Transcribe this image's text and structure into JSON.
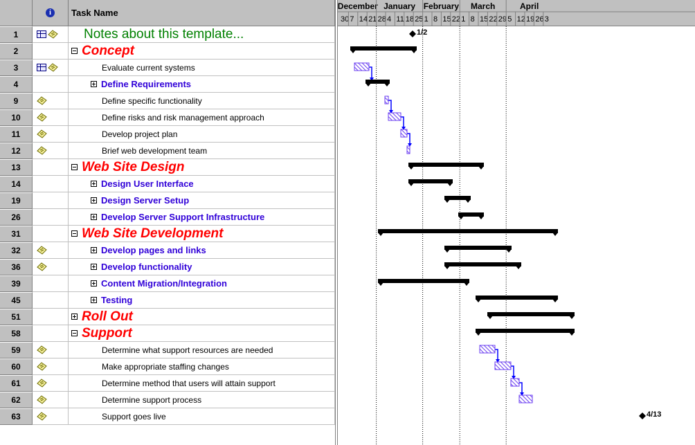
{
  "table": {
    "header": {
      "task_name": "Task Name"
    },
    "rows": [
      {
        "id": "1",
        "name": "Notes about this template...",
        "level": "title",
        "toggle": "",
        "indicators": [
          "grid",
          "note"
        ]
      },
      {
        "id": "2",
        "name": "Concept",
        "level": "phase",
        "toggle": "minus",
        "indicators": []
      },
      {
        "id": "3",
        "name": "Evaluate current systems",
        "level": "task",
        "toggle": "",
        "indicators": [
          "grid",
          "note"
        ]
      },
      {
        "id": "4",
        "name": "Define Requirements",
        "level": "summary",
        "toggle": "plus",
        "indicators": []
      },
      {
        "id": "9",
        "name": "Define specific functionality",
        "level": "task",
        "toggle": "",
        "indicators": [
          "note"
        ]
      },
      {
        "id": "10",
        "name": "Define risks and risk management approach",
        "level": "task",
        "toggle": "",
        "indicators": [
          "note"
        ]
      },
      {
        "id": "11",
        "name": "Develop project plan",
        "level": "task",
        "toggle": "",
        "indicators": [
          "note"
        ]
      },
      {
        "id": "12",
        "name": "Brief web development team",
        "level": "task",
        "toggle": "",
        "indicators": [
          "note"
        ]
      },
      {
        "id": "13",
        "name": "Web Site Design",
        "level": "phase",
        "toggle": "minus",
        "indicators": []
      },
      {
        "id": "14",
        "name": "Design User Interface",
        "level": "summary",
        "toggle": "plus",
        "indicators": []
      },
      {
        "id": "19",
        "name": "Design Server Setup",
        "level": "summary",
        "toggle": "plus",
        "indicators": []
      },
      {
        "id": "26",
        "name": "Develop Server Support Infrastructure",
        "level": "summary",
        "toggle": "plus",
        "indicators": []
      },
      {
        "id": "31",
        "name": "Web Site Development",
        "level": "phase",
        "toggle": "minus",
        "indicators": []
      },
      {
        "id": "32",
        "name": "Develop pages and links",
        "level": "summary",
        "toggle": "plus",
        "indicators": [
          "note"
        ]
      },
      {
        "id": "36",
        "name": "Develop functionality",
        "level": "summary",
        "toggle": "plus",
        "indicators": [
          "note"
        ]
      },
      {
        "id": "39",
        "name": "Content Migration/Integration",
        "level": "summary",
        "toggle": "plus",
        "indicators": []
      },
      {
        "id": "45",
        "name": "Testing",
        "level": "summary",
        "toggle": "plus",
        "indicators": []
      },
      {
        "id": "51",
        "name": "Roll Out",
        "level": "phase",
        "toggle": "plus",
        "indicators": []
      },
      {
        "id": "58",
        "name": "Support",
        "level": "phase",
        "toggle": "minus",
        "indicators": []
      },
      {
        "id": "59",
        "name": "Determine what support resources are needed",
        "level": "task",
        "toggle": "",
        "indicators": [
          "note"
        ]
      },
      {
        "id": "60",
        "name": "Make appropriate staffing changes",
        "level": "task",
        "toggle": "",
        "indicators": [
          "note"
        ]
      },
      {
        "id": "61",
        "name": "Determine method that users will attain support",
        "level": "task",
        "toggle": "",
        "indicators": [
          "note"
        ]
      },
      {
        "id": "62",
        "name": "Determine support process",
        "level": "task",
        "toggle": "",
        "indicators": [
          "note"
        ]
      },
      {
        "id": "63",
        "name": "Support goes live",
        "level": "task",
        "toggle": "",
        "indicators": [
          "note"
        ]
      }
    ]
  },
  "timescale": {
    "months": [
      "December",
      "January",
      "February",
      "March",
      "April"
    ],
    "weeks": [
      "30",
      "7",
      "14",
      "21",
      "28",
      "4",
      "11",
      "18",
      "25",
      "1",
      "8",
      "15",
      "22",
      "1",
      "8",
      "15",
      "22",
      "29",
      "5",
      "12",
      "19",
      "26",
      "3"
    ]
  },
  "gantt": {
    "bars": [
      {
        "row": 0,
        "type": "milestone",
        "start": "1/2",
        "label": "1/2"
      },
      {
        "row": 1,
        "type": "summary",
        "start": 18,
        "end": 114
      },
      {
        "row": 2,
        "type": "task",
        "start": 24,
        "end": 45
      },
      {
        "row": 3,
        "type": "summary",
        "start": 40,
        "end": 75
      },
      {
        "row": 4,
        "type": "task",
        "start": 68,
        "end": 73
      },
      {
        "row": 5,
        "type": "task",
        "start": 73,
        "end": 91
      },
      {
        "row": 6,
        "type": "task",
        "start": 91,
        "end": 100
      },
      {
        "row": 7,
        "type": "task",
        "start": 100,
        "end": 104
      },
      {
        "row": 8,
        "type": "summary",
        "start": 102,
        "end": 211
      },
      {
        "row": 9,
        "type": "summary",
        "start": 102,
        "end": 166
      },
      {
        "row": 10,
        "type": "summary",
        "start": 154,
        "end": 192
      },
      {
        "row": 11,
        "type": "summary",
        "start": 174,
        "end": 211
      },
      {
        "row": 12,
        "type": "summary",
        "start": 58,
        "end": 318
      },
      {
        "row": 13,
        "type": "summary",
        "start": 154,
        "end": 251
      },
      {
        "row": 14,
        "type": "summary",
        "start": 154,
        "end": 265
      },
      {
        "row": 15,
        "type": "summary",
        "start": 58,
        "end": 190
      },
      {
        "row": 16,
        "type": "summary",
        "start": 199,
        "end": 318
      },
      {
        "row": 17,
        "type": "summary",
        "start": 216,
        "end": 342
      },
      {
        "row": 18,
        "type": "summary",
        "start": 199,
        "end": 342
      },
      {
        "row": 19,
        "type": "task",
        "start": 205,
        "end": 227
      },
      {
        "row": 20,
        "type": "task",
        "start": 227,
        "end": 250
      },
      {
        "row": 21,
        "type": "task",
        "start": 250,
        "end": 262
      },
      {
        "row": 22,
        "type": "task",
        "start": 262,
        "end": 281
      },
      {
        "row": 23,
        "type": "milestone",
        "start": "4/13",
        "label": "4/13"
      }
    ],
    "links": [
      [
        2,
        3
      ],
      [
        4,
        5
      ],
      [
        5,
        6
      ],
      [
        6,
        7
      ],
      [
        19,
        20
      ],
      [
        20,
        21
      ],
      [
        21,
        22
      ]
    ],
    "colors": {
      "summary": "#000000",
      "task": "#6a3cf0",
      "link": "#0000ff",
      "grid": "#000000"
    }
  }
}
